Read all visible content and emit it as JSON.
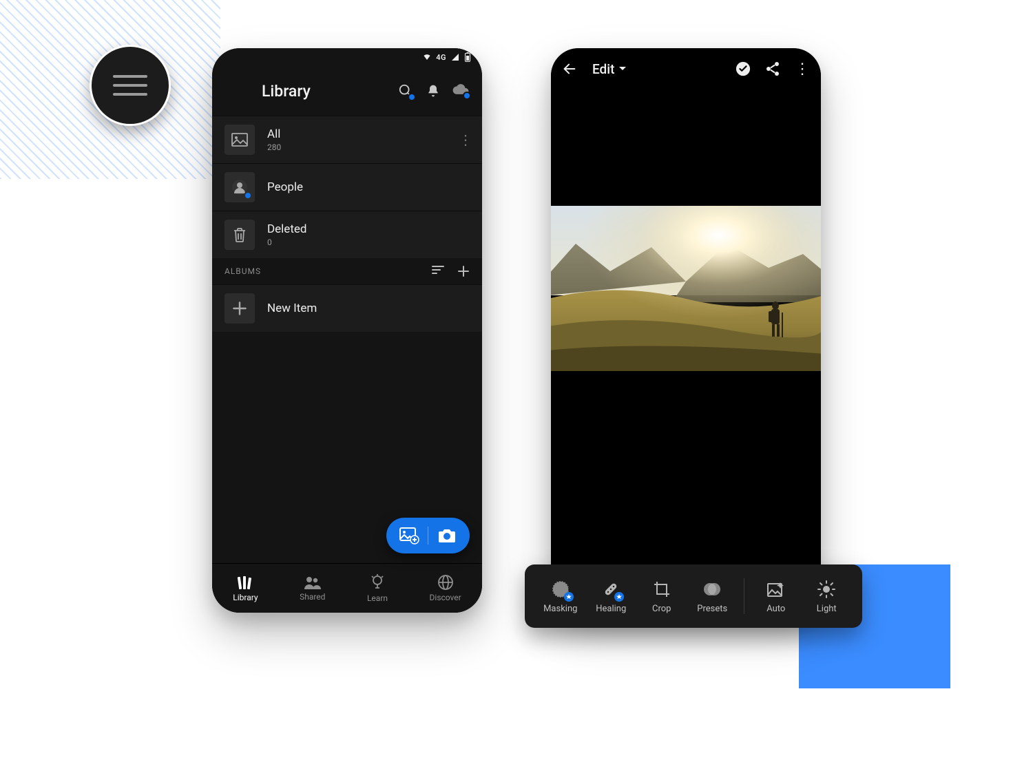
{
  "statusbar": {
    "network": "4G"
  },
  "library": {
    "title": "Library",
    "items": [
      {
        "title": "All",
        "count": "280"
      },
      {
        "title": "People",
        "count": ""
      },
      {
        "title": "Deleted",
        "count": "0"
      }
    ],
    "albums_header": "ALBUMS",
    "new_item_label": "New Item"
  },
  "bottom_nav": {
    "library": "Library",
    "shared": "Shared",
    "learn": "Learn",
    "discover": "Discover"
  },
  "editor": {
    "title": "Edit",
    "tools": {
      "masking": "Masking",
      "healing": "Healing",
      "crop": "Crop",
      "presets": "Presets",
      "auto": "Auto",
      "light": "Light"
    }
  }
}
